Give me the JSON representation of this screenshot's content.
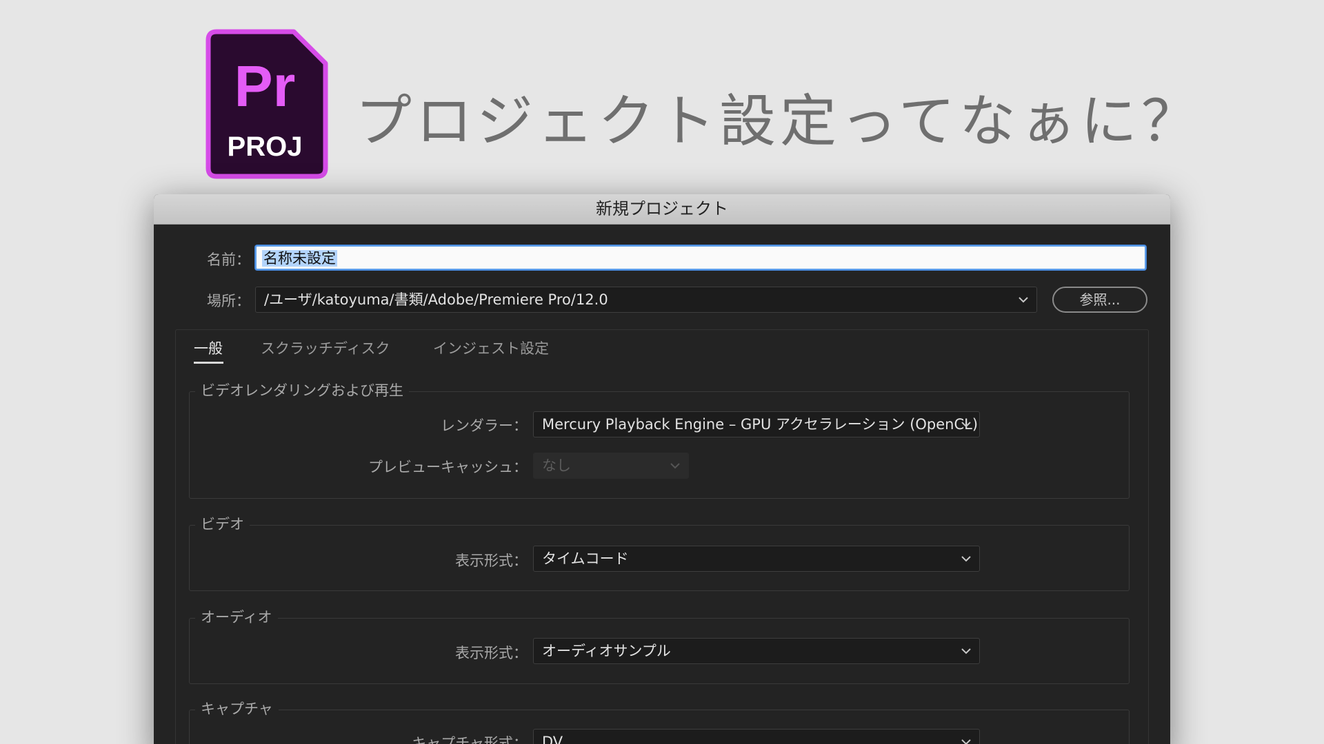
{
  "header": {
    "icon_label_top": "Pr",
    "icon_label_bottom": "PROJ",
    "headline": "プロジェクト設定ってなぁに？",
    "icon_colors": {
      "fill": "#2a0a2f",
      "border": "#d64ce8",
      "text_top": "#e45cf6",
      "text_bottom": "#ffffff"
    }
  },
  "dialog": {
    "title": "新規プロジェクト",
    "name": {
      "label": "名前：",
      "value": "名称未設定"
    },
    "location": {
      "label": "場所：",
      "value": "/ユーザ/katoyuma/書類/Adobe/Premiere Pro/12.0",
      "browse_label": "参照..."
    },
    "tabs": [
      {
        "label": "一般",
        "active": true
      },
      {
        "label": "スクラッチディスク",
        "active": false
      },
      {
        "label": "インジェスト設定",
        "active": false
      }
    ],
    "groups": {
      "video_rendering": {
        "title": "ビデオレンダリングおよび再生",
        "renderer_label": "レンダラー：",
        "renderer_value": "Mercury Playback Engine – GPU アクセラレーション (OpenCL)",
        "preview_cache_label": "プレビューキャッシュ：",
        "preview_cache_value": "なし"
      },
      "video": {
        "title": "ビデオ",
        "display_format_label": "表示形式：",
        "display_format_value": "タイムコード"
      },
      "audio": {
        "title": "オーディオ",
        "display_format_label": "表示形式：",
        "display_format_value": "オーディオサンプル"
      },
      "capture": {
        "title": "キャプチャ",
        "capture_format_label": "キャプチャ形式：",
        "capture_format_value": "DV"
      }
    }
  },
  "colors": {
    "page_background": "#e6e6e6",
    "dialog_background": "#232323",
    "focus_ring": "#5f9ee8",
    "selection": "#b3d4fb"
  }
}
